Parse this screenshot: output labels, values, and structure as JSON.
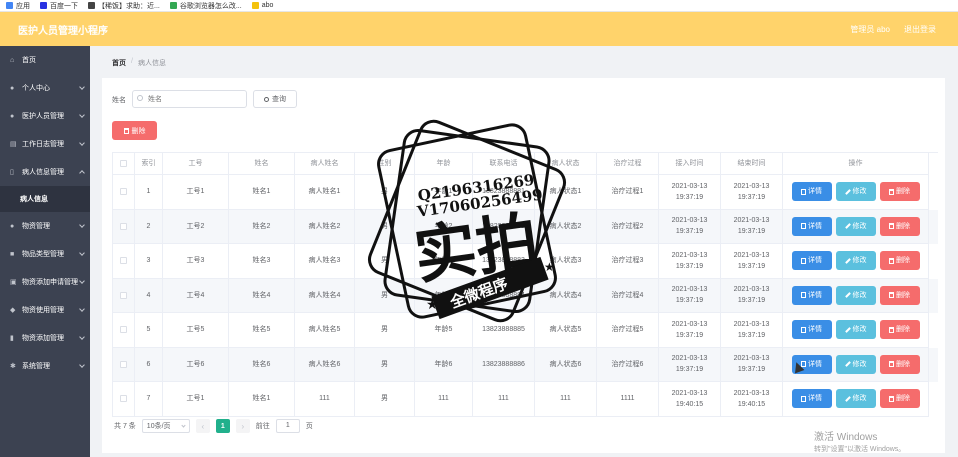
{
  "bookmarks": [
    {
      "label": "应用",
      "color": "#4285f4"
    },
    {
      "label": "百度一下",
      "color": "#2932e1"
    },
    {
      "label": "【稀饭】求助：近...",
      "color": "#444444"
    },
    {
      "label": "谷歌浏览器怎么改...",
      "color": "#34a853"
    },
    {
      "label": "abo",
      "color": "#f4c20d"
    }
  ],
  "header": {
    "title": "医护人员管理小程序",
    "user": "管理员 abo",
    "logout": "退出登录"
  },
  "sidebar": {
    "items": [
      {
        "label": "首页",
        "icon": "home-icon",
        "glyph": "⌂",
        "chevron": ""
      },
      {
        "label": "个人中心",
        "icon": "user-icon",
        "glyph": "●",
        "chevron": "down"
      },
      {
        "label": "医护人员管理",
        "icon": "doctor-icon",
        "glyph": "●",
        "chevron": "down"
      },
      {
        "label": "工作日志管理",
        "icon": "log-icon",
        "glyph": "▤",
        "chevron": "down"
      },
      {
        "label": "病人信息管理",
        "icon": "patient-icon",
        "glyph": "▯",
        "chevron": "up"
      },
      {
        "label": "病人信息",
        "icon": "",
        "glyph": "",
        "chevron": "",
        "sub": true
      },
      {
        "label": "物资管理",
        "icon": "supplies-icon",
        "glyph": "●",
        "chevron": "down"
      },
      {
        "label": "物品类型管理",
        "icon": "type-icon",
        "glyph": "■",
        "chevron": "down"
      },
      {
        "label": "物资添加申请管理",
        "icon": "apply-icon",
        "glyph": "▣",
        "chevron": "down"
      },
      {
        "label": "物资使用管理",
        "icon": "usage-icon",
        "glyph": "◆",
        "chevron": "down"
      },
      {
        "label": "物资添加管理",
        "icon": "add-icon",
        "glyph": "▮",
        "chevron": "down"
      },
      {
        "label": "系统管理",
        "icon": "system-icon",
        "glyph": "✱",
        "chevron": "down"
      }
    ]
  },
  "breadcrumb": {
    "home": "首页",
    "sep": "/",
    "current": "病人信息"
  },
  "search": {
    "label": "姓名",
    "placeholder": "姓名",
    "button": "查询"
  },
  "bulk_delete": "删除",
  "table": {
    "headers": [
      "索引",
      "工号",
      "姓名",
      "病人姓名",
      "性别",
      "年龄",
      "联系电话",
      "病人状态",
      "治疗过程",
      "接入时间",
      "结束时间",
      "操作"
    ],
    "rows": [
      [
        "1",
        "工号1",
        "姓名1",
        "病人姓名1",
        "男",
        "年龄1",
        "13823888881",
        "病人状态1",
        "治疗过程1",
        "2021-03-13 19:37:19",
        "2021-03-13 19:37:19"
      ],
      [
        "2",
        "工号2",
        "姓名2",
        "病人姓名2",
        "男",
        "年龄2",
        "13823888882",
        "病人状态2",
        "治疗过程2",
        "2021-03-13 19:37:19",
        "2021-03-13 19:37:19"
      ],
      [
        "3",
        "工号3",
        "姓名3",
        "病人姓名3",
        "男",
        "年龄3",
        "13823888883",
        "病人状态3",
        "治疗过程3",
        "2021-03-13 19:37:19",
        "2021-03-13 19:37:19"
      ],
      [
        "4",
        "工号4",
        "姓名4",
        "病人姓名4",
        "男",
        "年龄4",
        "13823888884",
        "病人状态4",
        "治疗过程4",
        "2021-03-13 19:37:19",
        "2021-03-13 19:37:19"
      ],
      [
        "5",
        "工号5",
        "姓名5",
        "病人姓名5",
        "男",
        "年龄5",
        "13823888885",
        "病人状态5",
        "治疗过程5",
        "2021-03-13 19:37:19",
        "2021-03-13 19:37:19"
      ],
      [
        "6",
        "工号6",
        "姓名6",
        "病人姓名6",
        "男",
        "年龄6",
        "13823888886",
        "病人状态6",
        "治疗过程6",
        "2021-03-13 19:37:19",
        "2021-03-13 19:37:19"
      ],
      [
        "7",
        "工号1",
        "姓名1",
        "111",
        "男",
        "111",
        "111",
        "111",
        "1111",
        "2021-03-13 19:40:15",
        "2021-03-13 19:40:15"
      ]
    ],
    "actions": {
      "detail": "详情",
      "edit": "修改",
      "delete": "删除"
    }
  },
  "pagination": {
    "total": "共 7 条",
    "page_size": "10条/页",
    "prev": "‹",
    "current": "1",
    "next": "›",
    "goto_prefix": "前往",
    "goto_value": "1",
    "goto_suffix": "页"
  },
  "watermark": {
    "line1": "Q2196316269",
    "line2": "V17060256499",
    "main": "实拍",
    "banner": "全微程序"
  },
  "windows_activation": {
    "line1": "激活 Windows",
    "line2": "转到\"设置\"以激活 Windows。"
  },
  "colors": {
    "header": "#ffd36b",
    "sidebar": "#3c4251",
    "danger": "#f56c6c",
    "primary": "#3a8ee6",
    "info": "#5bc0de",
    "page_active": "#21b08c"
  }
}
